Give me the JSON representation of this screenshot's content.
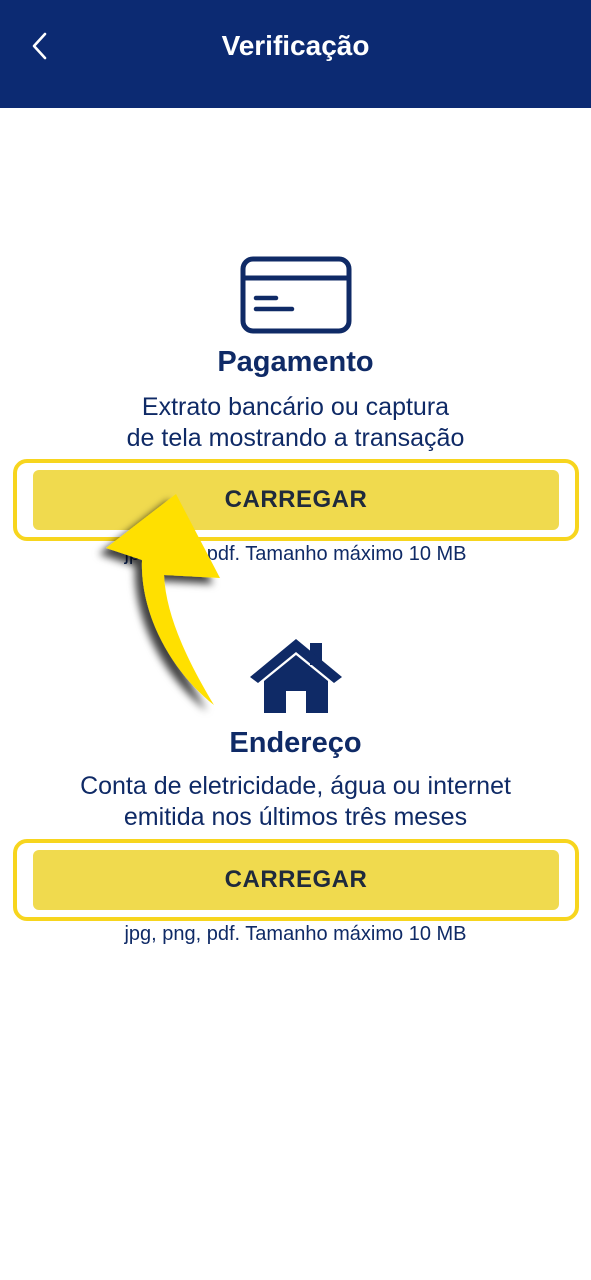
{
  "header": {
    "title": "Verificação",
    "back_icon": "chevron-left-icon",
    "background_color": "#0c2a72"
  },
  "payment": {
    "icon": "credit-card-icon",
    "title": "Pagamento",
    "description_line1": "Extrato bancário ou captura",
    "description_line2": "de tela mostrando a transação",
    "upload_label": "CARREGAR",
    "formats": "jpg, png, pdf. Tamanho máximo 10 MB"
  },
  "address": {
    "icon": "house-icon",
    "title": "Endereço",
    "description_line1": "Conta de eletricidade, água ou internet",
    "description_line2": "emitida nos últimos três meses",
    "upload_label": "CARREGAR",
    "formats": "jpg, png, pdf. Tamanho máximo 10 MB"
  },
  "annotation": {
    "arrow_icon": "curved-arrow-icon",
    "highlight_color": "#f7d51e",
    "button_color": "#f0da4e"
  }
}
